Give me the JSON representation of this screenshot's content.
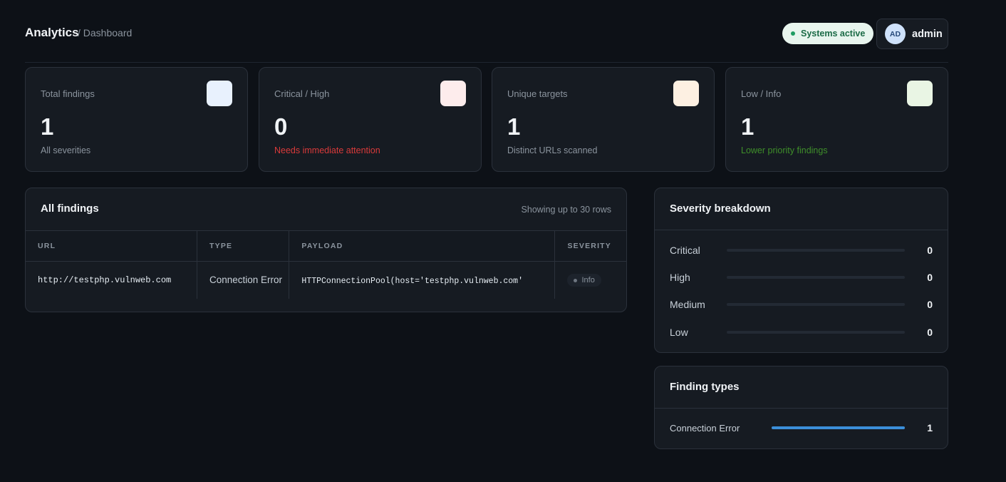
{
  "header": {
    "brand": "Analytics",
    "breadcrumb": "/ Dashboard",
    "status": "Systems active",
    "user_initials": "AD",
    "user_name": "admin"
  },
  "stats": [
    {
      "label": "Total findings",
      "value": "1",
      "sub": "All severities",
      "icon_color": "#e8f1fd"
    },
    {
      "label": "Critical / High",
      "value": "0",
      "sub": "Needs immediate attention",
      "icon_color": "#fdecec"
    },
    {
      "label": "Unique targets",
      "value": "1",
      "sub": "Distinct URLs scanned",
      "icon_color": "#fdf0e2"
    },
    {
      "label": "Low / Info",
      "value": "1",
      "sub": "Lower priority findings",
      "icon_color": "#e9f5e4"
    }
  ],
  "findings": {
    "title": "All findings",
    "meta": "Showing up to 30 rows",
    "columns": [
      "URL",
      "TYPE",
      "PAYLOAD",
      "SEVERITY"
    ],
    "rows": [
      {
        "url": "http://testphp.vulnweb.com",
        "type": "Connection Error",
        "payload": "HTTPConnectionPool(host='testphp.vulnweb.com'",
        "severity": "Info"
      }
    ]
  },
  "breakdown": {
    "title": "Severity breakdown",
    "items": [
      {
        "label": "Critical",
        "count": "0",
        "fraction": 0
      },
      {
        "label": "High",
        "count": "0",
        "fraction": 0
      },
      {
        "label": "Medium",
        "count": "0",
        "fraction": 0
      },
      {
        "label": "Low",
        "count": "0",
        "fraction": 0
      }
    ]
  },
  "types": {
    "title": "Finding types",
    "items": [
      {
        "label": "Connection Error",
        "count": "1",
        "fraction": 1
      }
    ]
  },
  "colors": {
    "accent": "#3b8fd9",
    "critical": "#d93a3a",
    "low": "#3f8f2a",
    "status_bg": "#e8f5ee"
  }
}
